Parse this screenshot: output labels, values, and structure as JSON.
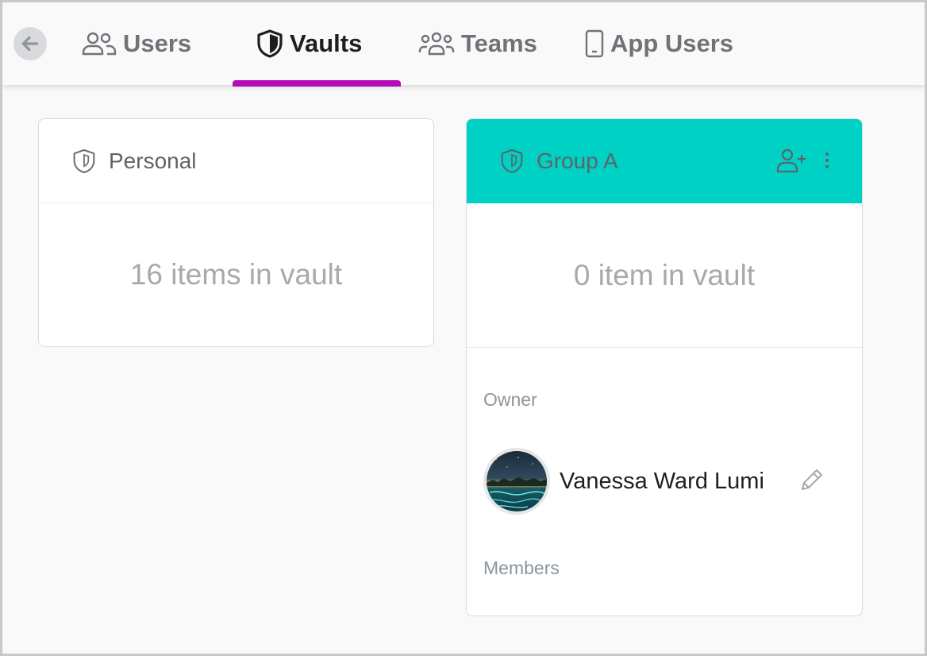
{
  "nav": {
    "back_icon": "arrow-left-icon",
    "tabs": [
      {
        "label": "Users",
        "icon": "users-icon",
        "active": false
      },
      {
        "label": "Vaults",
        "icon": "shield-icon",
        "active": true
      },
      {
        "label": "Teams",
        "icon": "team-icon",
        "active": false
      },
      {
        "label": "App Users",
        "icon": "mobile-phone-icon",
        "active": false
      }
    ],
    "active_color": "#b50ab8"
  },
  "vaults": [
    {
      "name": "Personal",
      "items_text": "16 items in vault",
      "header_color": "#ffffff"
    },
    {
      "name": "Group A",
      "items_text": "0 item in vault",
      "header_color": "#00d1c5",
      "owner_label": "Owner",
      "owner_name": "Vanessa Ward Lumi",
      "members_label": "Members",
      "actions": [
        "add-user-icon",
        "more-vertical-icon"
      ]
    }
  ]
}
